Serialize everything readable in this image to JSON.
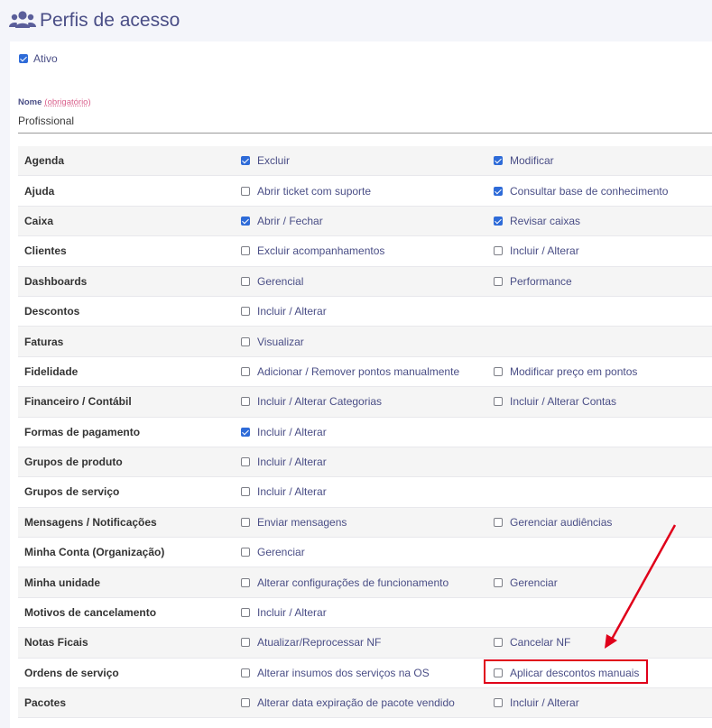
{
  "header": {
    "title": "Perfis de acesso",
    "icon": "users-icon"
  },
  "ativo": {
    "label": "Ativo",
    "checked": true
  },
  "nome": {
    "label": "Nome",
    "required": "(obrigatório)",
    "value": "Profissional"
  },
  "permissions": [
    {
      "label": "Agenda",
      "c1": {
        "text": "Excluir",
        "checked": true
      },
      "c2": {
        "text": "Modificar",
        "checked": true
      }
    },
    {
      "label": "Ajuda",
      "c1": {
        "text": "Abrir ticket com suporte",
        "checked": false
      },
      "c2": {
        "text": "Consultar base de conhecimento",
        "checked": true
      }
    },
    {
      "label": "Caixa",
      "c1": {
        "text": "Abrir / Fechar",
        "checked": true
      },
      "c2": {
        "text": "Revisar caixas",
        "checked": true
      }
    },
    {
      "label": "Clientes",
      "c1": {
        "text": "Excluir acompanhamentos",
        "checked": false
      },
      "c2": {
        "text": "Incluir / Alterar",
        "checked": false
      }
    },
    {
      "label": "Dashboards",
      "c1": {
        "text": "Gerencial",
        "checked": false
      },
      "c2": {
        "text": "Performance",
        "checked": false
      }
    },
    {
      "label": "Descontos",
      "c1": {
        "text": "Incluir / Alterar",
        "checked": false
      },
      "c2": null
    },
    {
      "label": "Faturas",
      "c1": {
        "text": "Visualizar",
        "checked": false
      },
      "c2": null
    },
    {
      "label": "Fidelidade",
      "c1": {
        "text": "Adicionar / Remover pontos manualmente",
        "checked": false
      },
      "c2": {
        "text": "Modificar preço em pontos",
        "checked": false
      }
    },
    {
      "label": "Financeiro / Contábil",
      "c1": {
        "text": "Incluir / Alterar Categorias",
        "checked": false
      },
      "c2": {
        "text": "Incluir / Alterar Contas",
        "checked": false
      }
    },
    {
      "label": "Formas de pagamento",
      "c1": {
        "text": "Incluir / Alterar",
        "checked": true
      },
      "c2": null
    },
    {
      "label": "Grupos de produto",
      "c1": {
        "text": "Incluir / Alterar",
        "checked": false
      },
      "c2": null
    },
    {
      "label": "Grupos de serviço",
      "c1": {
        "text": "Incluir / Alterar",
        "checked": false
      },
      "c2": null
    },
    {
      "label": "Mensagens / Notificações",
      "c1": {
        "text": "Enviar mensagens",
        "checked": false
      },
      "c2": {
        "text": "Gerenciar audiências",
        "checked": false
      }
    },
    {
      "label": "Minha Conta (Organização)",
      "c1": {
        "text": "Gerenciar",
        "checked": false
      },
      "c2": null
    },
    {
      "label": "Minha unidade",
      "c1": {
        "text": "Alterar configurações de funcionamento",
        "checked": false
      },
      "c2": {
        "text": "Gerenciar",
        "checked": false
      }
    },
    {
      "label": "Motivos de cancelamento",
      "c1": {
        "text": "Incluir / Alterar",
        "checked": false
      },
      "c2": null
    },
    {
      "label": "Notas Ficais",
      "c1": {
        "text": "Atualizar/Reprocessar NF",
        "checked": false
      },
      "c2": {
        "text": "Cancelar NF",
        "checked": false
      }
    },
    {
      "label": "Ordens de serviço",
      "c1": {
        "text": "Alterar insumos dos serviços na OS",
        "checked": false
      },
      "c2": {
        "text": "Aplicar descontos manuais",
        "checked": false
      }
    },
    {
      "label": "Pacotes",
      "c1": {
        "text": "Alterar data expiração de pacote vendido",
        "checked": false
      },
      "c2": {
        "text": "Incluir / Alterar",
        "checked": false
      }
    }
  ],
  "colors": {
    "accent": "#2e6bd8",
    "text": "#4a4e86",
    "annotation": "#e0001a"
  }
}
